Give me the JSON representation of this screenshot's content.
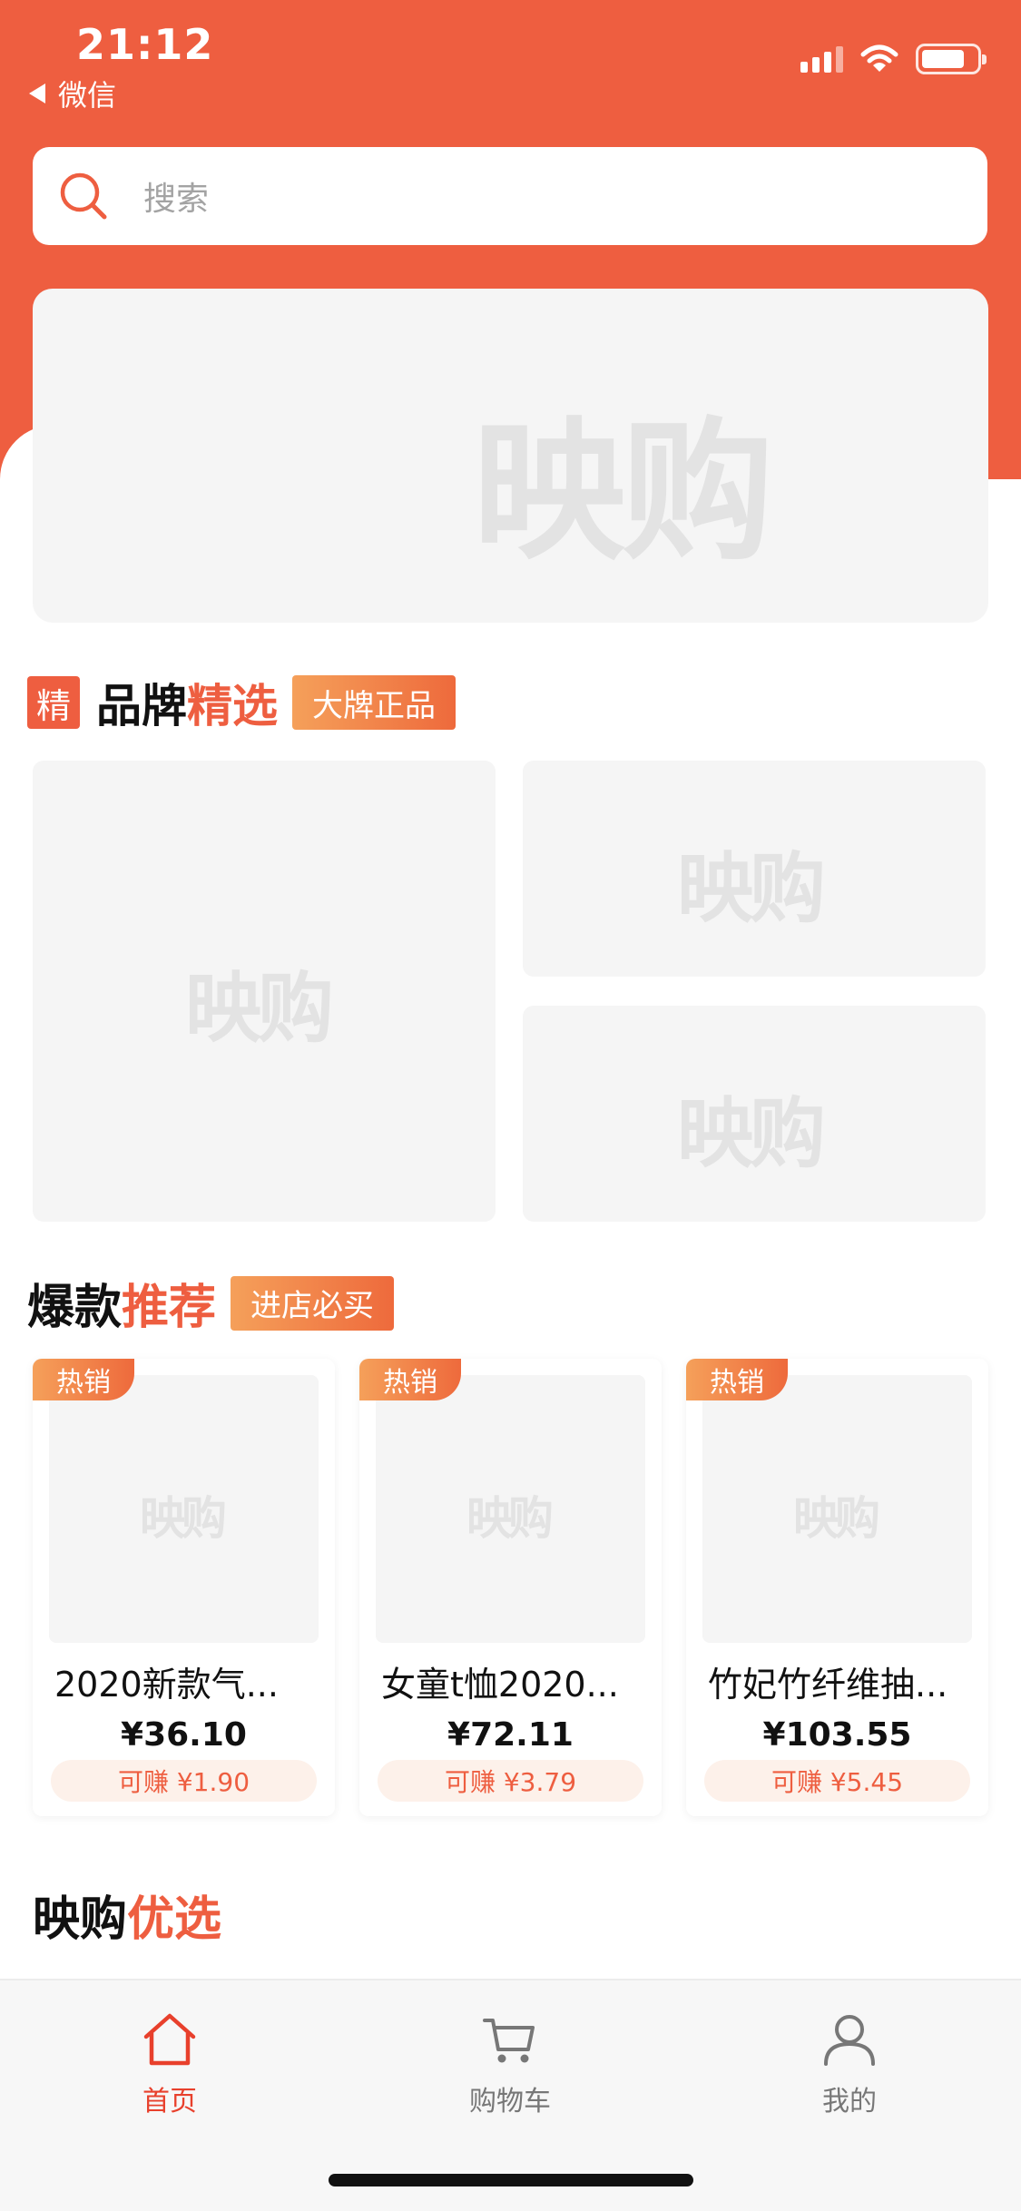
{
  "status_bar": {
    "time": "21:12",
    "back_label": "微信"
  },
  "search": {
    "placeholder": "搜索"
  },
  "watermark": "映购",
  "brand_section": {
    "tag_char": "精",
    "title_black": "品牌",
    "title_orange": "精选",
    "badge": "大牌正品"
  },
  "hot_section": {
    "title_black": "爆款",
    "title_orange": "推荐",
    "badge": "进店必买",
    "products": [
      {
        "hot": "热销",
        "name": "2020新款气...",
        "price": "¥36.10",
        "earn": "可赚 ¥1.90"
      },
      {
        "hot": "热销",
        "name": "女童t恤2020...",
        "price": "¥72.11",
        "earn": "可赚 ¥3.79"
      },
      {
        "hot": "热销",
        "name": "竹妃竹纤维抽...",
        "price": "¥103.55",
        "earn": "可赚 ¥5.45"
      }
    ]
  },
  "pick_section": {
    "title_black": "映购",
    "title_orange": "优选"
  },
  "tabbar": {
    "items": [
      {
        "label": "首页",
        "icon": "home-icon",
        "active": true
      },
      {
        "label": "购物车",
        "icon": "cart-icon",
        "active": false
      },
      {
        "label": "我的",
        "icon": "user-icon",
        "active": false
      }
    ]
  },
  "colors": {
    "brand": "#ee5e40",
    "active_tab": "#e8402c",
    "inactive_tab": "#777777"
  }
}
